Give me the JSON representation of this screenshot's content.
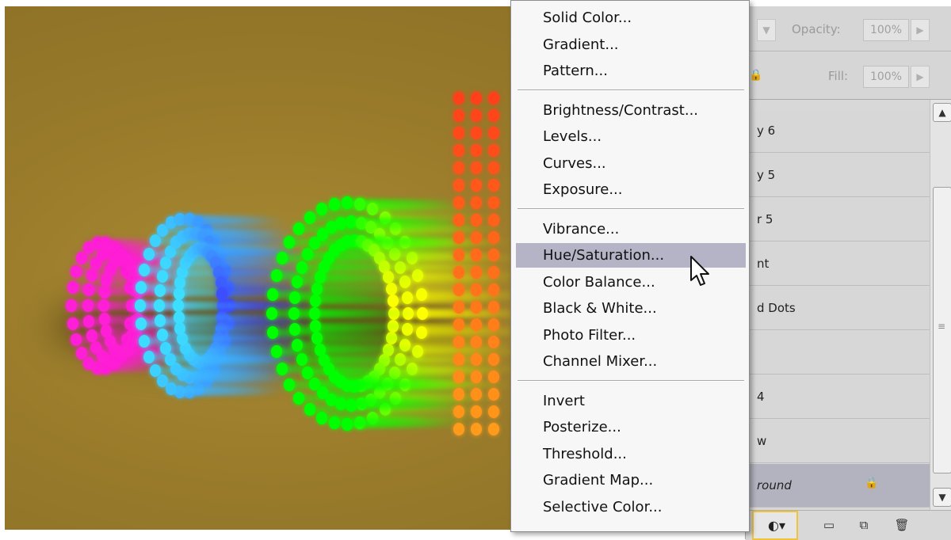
{
  "menu": {
    "groups": [
      [
        "Solid Color...",
        "Gradient...",
        "Pattern..."
      ],
      [
        "Brightness/Contrast...",
        "Levels...",
        "Curves...",
        "Exposure..."
      ],
      [
        "Vibrance...",
        "Hue/Saturation...",
        "Color Balance...",
        "Black & White...",
        "Photo Filter...",
        "Channel Mixer..."
      ],
      [
        "Invert",
        "Posterize...",
        "Threshold...",
        "Gradient Map...",
        "Selective Color..."
      ]
    ],
    "highlighted": "Hue/Saturation..."
  },
  "layers_panel": {
    "opacity_label": "Opacity:",
    "opacity_value": "100%",
    "fill_label": "Fill:",
    "fill_value": "100%",
    "layers": [
      {
        "name": "y 6"
      },
      {
        "name": "y 5"
      },
      {
        "name": "r 5"
      },
      {
        "name": "nt"
      },
      {
        "name": "d Dots"
      },
      {
        "name": ""
      },
      {
        "name": "4"
      },
      {
        "name": "w"
      },
      {
        "name": "round"
      }
    ]
  },
  "icons": {
    "adjustment": "adjustment-layer-icon",
    "group": "folder-icon",
    "new_layer": "new-layer-icon",
    "delete": "trash-icon",
    "lock": "lock-icon",
    "scroll_up": "chevron-up-icon",
    "scroll_down": "chevron-down-icon",
    "cursor": "mouse-pointer-icon"
  },
  "colors": {
    "canvas_bg": "#9a7c2c",
    "menu_highlight": "#b4b4c6",
    "adjust_button_outline": "#f0c43a"
  }
}
